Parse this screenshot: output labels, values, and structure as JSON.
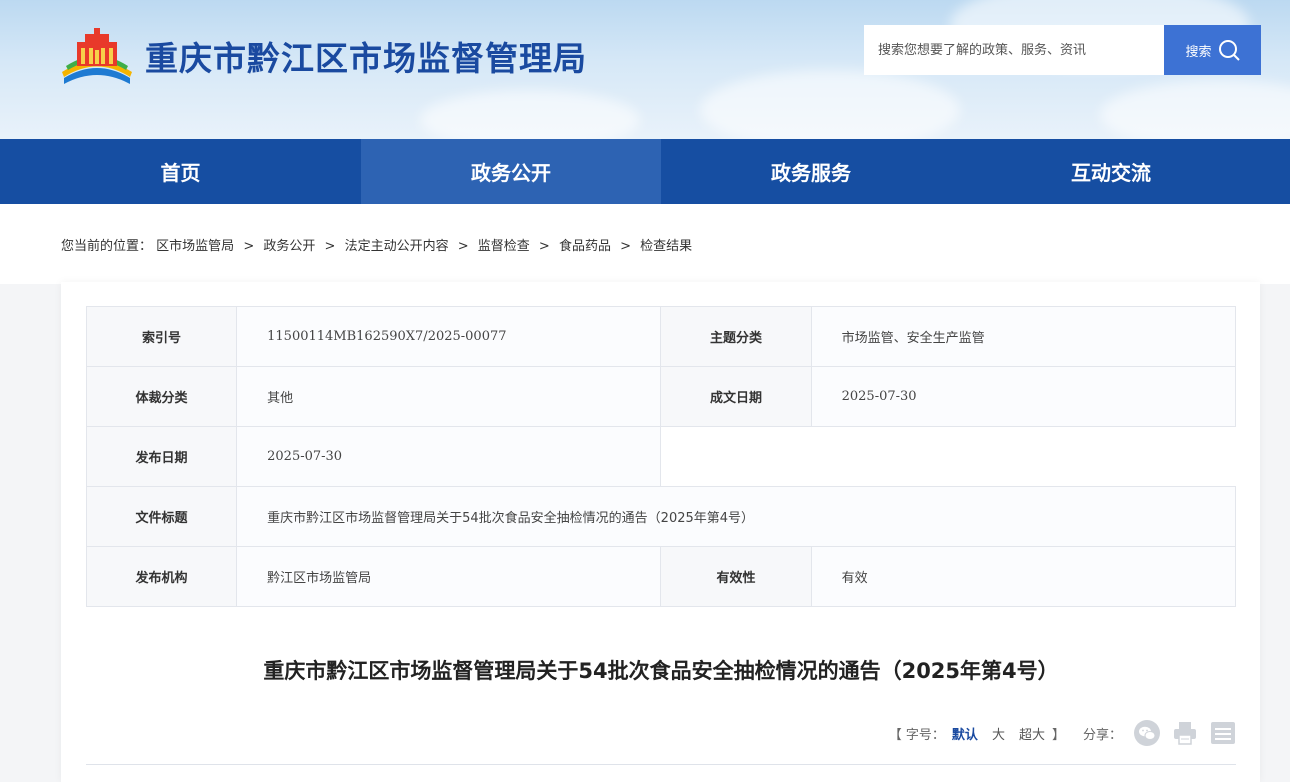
{
  "header": {
    "site_title": "重庆市黔江区市场监督管理局",
    "search_placeholder": "搜索您想要了解的政策、服务、资讯",
    "search_button": "搜索"
  },
  "nav": {
    "items": [
      {
        "label": "首页"
      },
      {
        "label": "政务公开"
      },
      {
        "label": "政务服务"
      },
      {
        "label": "互动交流"
      }
    ]
  },
  "breadcrumb": {
    "prefix": "您当前的位置：",
    "items": [
      "区市场监管局",
      "政务公开",
      "法定主动公开内容",
      "监督检查",
      "食品药品",
      "检查结果"
    ],
    "separator": ">"
  },
  "meta": {
    "index_no_label": "索引号",
    "index_no": "11500114MB162590X7/2025-00077",
    "topic_label": "主题分类",
    "topic": "市场监管、安全生产监管",
    "genre_label": "体裁分类",
    "genre": "其他",
    "written_date_label": "成文日期",
    "written_date": "2025-07-30",
    "publish_date_label": "发布日期",
    "publish_date": "2025-07-30",
    "file_title_label": "文件标题",
    "file_title": "重庆市黔江区市场监督管理局关于54批次食品安全抽检情况的通告（2025年第4号）",
    "issuer_label": "发布机构",
    "issuer": "黔江区市场监管局",
    "validity_label": "有效性",
    "validity": "有效"
  },
  "article": {
    "title": "重庆市黔江区市场监督管理局关于54批次食品安全抽检情况的通告（2025年第4号）"
  },
  "tools": {
    "font_size_prefix": "【 字号：",
    "font_default": "默认",
    "font_large": "大",
    "font_xlarge": "超大",
    "font_size_suffix": "】",
    "share_label": "分享："
  },
  "colors": {
    "nav_bg": "#164ea2",
    "nav_active": "#2d63b3",
    "title_blue": "#1a4aa0",
    "search_btn": "#3d72d4"
  }
}
